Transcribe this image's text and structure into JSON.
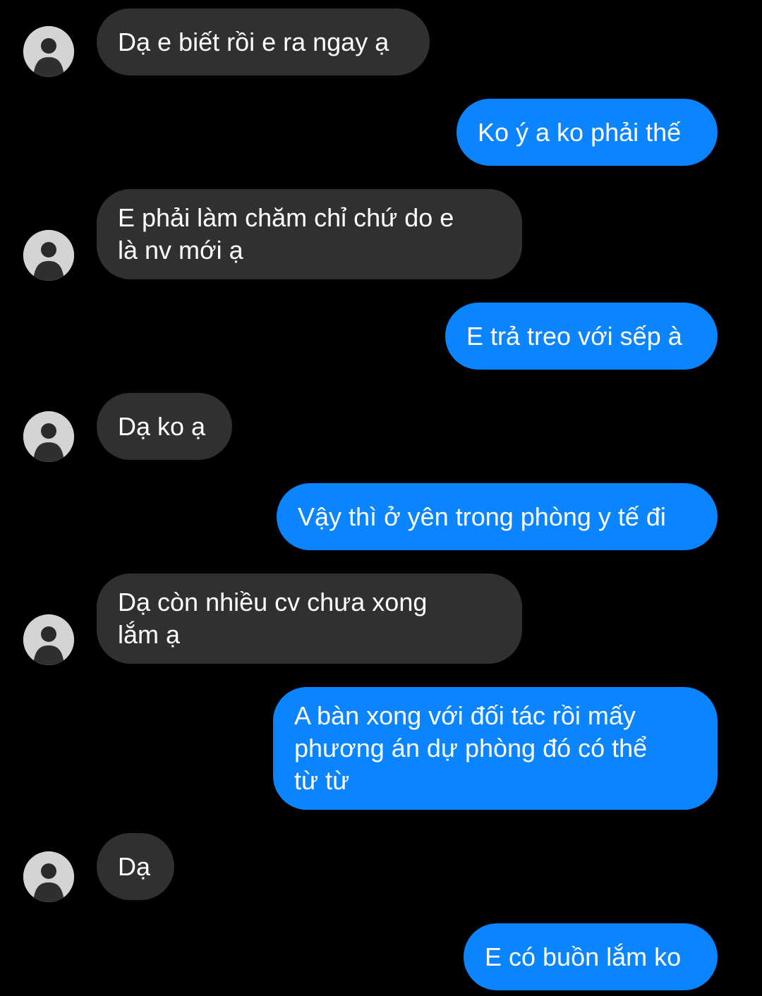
{
  "chat": {
    "messages": [
      {
        "from": "other",
        "text": "Dạ e biết rồi e ra ngay ạ"
      },
      {
        "from": "me",
        "text": "Ko ý a ko phải thế"
      },
      {
        "from": "other",
        "text": "E phải làm chăm chỉ chứ do e\nlà nv mới ạ"
      },
      {
        "from": "me",
        "text": "E trả treo với sếp à"
      },
      {
        "from": "other",
        "text": "Dạ ko ạ"
      },
      {
        "from": "me",
        "text": "Vậy thì ở yên trong phòng y tế đi"
      },
      {
        "from": "other",
        "text": "Dạ còn nhiều cv chưa xong\nlắm ạ"
      },
      {
        "from": "me",
        "text": "A bàn xong với đối tác rồi mấy\nphương án dự phòng đó có thể\ntừ từ"
      },
      {
        "from": "other",
        "text": "Dạ"
      },
      {
        "from": "me",
        "text": "E có buồn lắm ko"
      }
    ]
  },
  "colors": {
    "background": "#000000",
    "incoming_bubble": "#303030",
    "outgoing_bubble": "#0a84ff",
    "text": "#ffffff"
  },
  "icons": {
    "avatar": "contact-avatar-photo"
  }
}
